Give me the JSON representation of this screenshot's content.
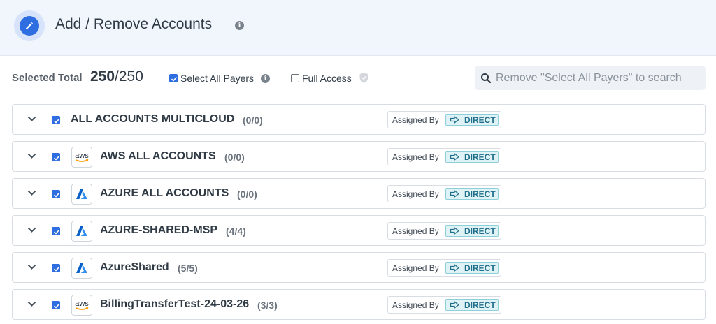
{
  "header": {
    "title": "Add / Remove Accounts",
    "icon": "pencil-icon",
    "info_icon": "info-icon"
  },
  "toolbar": {
    "selected_total_label": "Selected Total",
    "selected_count": "250",
    "total_count": "/250",
    "select_all_payers": {
      "label": "Select All Payers",
      "checked": true
    },
    "full_access": {
      "label": "Full Access",
      "checked": false,
      "icon": "shield-icon"
    },
    "search": {
      "placeholder": "Remove \"Select All Payers\" to search",
      "value": "",
      "icon": "search-icon"
    }
  },
  "accounts": [
    {
      "name": "ALL ACCOUNTS MULTICLOUD",
      "count": "(0/0)",
      "checked": true,
      "provider": "none",
      "assigned_by_label": "Assigned By",
      "assignment": "DIRECT"
    },
    {
      "name": "AWS ALL ACCOUNTS",
      "count": "(0/0)",
      "checked": true,
      "provider": "aws",
      "logo_text": "aws",
      "assigned_by_label": "Assigned By",
      "assignment": "DIRECT"
    },
    {
      "name": "AZURE ALL ACCOUNTS",
      "count": "(0/0)",
      "checked": true,
      "provider": "azure",
      "assigned_by_label": "Assigned By",
      "assignment": "DIRECT"
    },
    {
      "name": "AZURE-SHARED-MSP",
      "count": "(4/4)",
      "checked": true,
      "provider": "azure",
      "assigned_by_label": "Assigned By",
      "assignment": "DIRECT"
    },
    {
      "name": "AzureShared",
      "count": "(5/5)",
      "checked": true,
      "provider": "azure",
      "assigned_by_label": "Assigned By",
      "assignment": "DIRECT"
    },
    {
      "name": "BillingTransferTest-24-03-26",
      "count": "(3/3)",
      "checked": true,
      "provider": "aws",
      "logo_text": "aws",
      "assigned_by_label": "Assigned By",
      "assignment": "DIRECT"
    }
  ],
  "colors": {
    "accent": "#2f6ee0",
    "header_bg": "#f1f5fc",
    "direct_badge_bg": "#dff3f6",
    "direct_badge_text": "#1f6f8b"
  }
}
